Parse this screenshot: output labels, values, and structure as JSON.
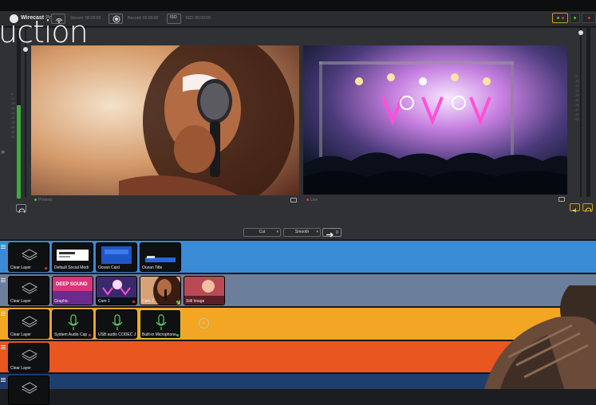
{
  "app": {
    "brand": "Wirecast",
    "edition": "Pro"
  },
  "toolbar": {
    "stream_label": "Stream: 00:00:00",
    "record_label": "Record: 00:00:00",
    "iso_label": "ISO: 00:00:00",
    "iso_icon_text": "ISO"
  },
  "overlay_text": "uction",
  "preview": {
    "left_label": "Preview",
    "right_label": "Live",
    "left_ticks": [
      "-5",
      "-10",
      "-15",
      "-20",
      "-25",
      "-30",
      "-35",
      "-40",
      "-45",
      "-50"
    ],
    "right_ticks": [
      "-5",
      "-10",
      "-15",
      "-20",
      "-25",
      "-30",
      "-35",
      "-40",
      "-45",
      "-50"
    ],
    "left_meter_level": 0.55,
    "right_meter_level": 0.0
  },
  "transition": {
    "cut_label": "Cut",
    "smooth_label": "Smooth",
    "go_label": "0"
  },
  "layers": [
    {
      "color": "#3a8bd6",
      "shots": [
        {
          "label": "Clear Layer",
          "kind": "clear",
          "indicator": "#d33"
        },
        {
          "label": "Default Social Medi",
          "kind": "social",
          "indicator": ""
        },
        {
          "label": "Ocean Card",
          "kind": "ocean_card",
          "indicator": ""
        },
        {
          "label": "Ocean Title",
          "kind": "ocean_title",
          "indicator": ""
        }
      ]
    },
    {
      "color": "#6b7f9d",
      "shots": [
        {
          "label": "Clear Layer",
          "kind": "clear",
          "indicator": ""
        },
        {
          "label": "Graphic",
          "kind": "graphic",
          "indicator": "",
          "graphic_text": "DEEP SOUND"
        },
        {
          "label": "Cam 1",
          "kind": "cam1",
          "indicator": "#d33"
        },
        {
          "label": "Cam 2",
          "kind": "cam2",
          "indicator": "#3c3"
        },
        {
          "label": "Still Image",
          "kind": "still",
          "indicator": ""
        }
      ]
    },
    {
      "color": "#f2a623",
      "shots": [
        {
          "label": "Clear Layer",
          "kind": "clear",
          "indicator": ""
        },
        {
          "label": "System Audio Cap",
          "kind": "audio",
          "indicator": "#d33"
        },
        {
          "label": "USB audio CODEC J",
          "kind": "audio",
          "indicator": ""
        },
        {
          "label": "Built-in Microphone",
          "kind": "audio",
          "indicator": "#3c3"
        }
      ]
    },
    {
      "color": "#e9561f",
      "shots": [
        {
          "label": "Clear Layer",
          "kind": "clear",
          "indicator": ""
        }
      ]
    },
    {
      "color": "#1e3f6e",
      "shots": [
        {
          "label": "",
          "kind": "clear",
          "indicator": ""
        }
      ]
    }
  ],
  "colors": {
    "accent_gold": "#c8a02a",
    "live_red": "#d33",
    "preview_green": "#3c3"
  }
}
